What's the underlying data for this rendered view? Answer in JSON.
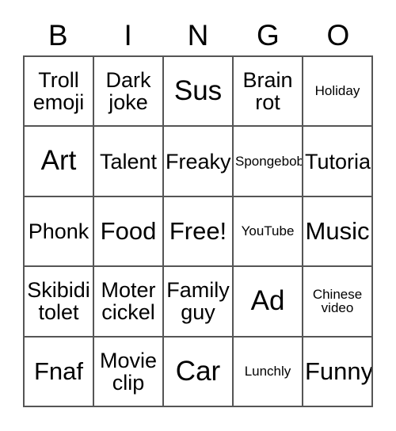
{
  "card": {
    "header_letters": [
      "B",
      "I",
      "N",
      "G",
      "O"
    ],
    "rows": [
      [
        {
          "text": "Troll\nemoji",
          "size": "md"
        },
        {
          "text": "Dark\njoke",
          "size": "md"
        },
        {
          "text": "Sus",
          "size": "xl"
        },
        {
          "text": "Brain\nrot",
          "size": "md"
        },
        {
          "text": "Holiday",
          "size": "sm"
        }
      ],
      [
        {
          "text": "Art",
          "size": "xl"
        },
        {
          "text": "Talent",
          "size": "md"
        },
        {
          "text": "Freaky",
          "size": "md"
        },
        {
          "text": "Spongebob",
          "size": "sm"
        },
        {
          "text": "Tutorial",
          "size": "md"
        }
      ],
      [
        {
          "text": "Phonk",
          "size": "md"
        },
        {
          "text": "Food",
          "size": "lg"
        },
        {
          "text": "Free!",
          "size": "lg"
        },
        {
          "text": "YouTube",
          "size": "sm"
        },
        {
          "text": "Music",
          "size": "lg"
        }
      ],
      [
        {
          "text": "Skibidi\ntolet",
          "size": "md"
        },
        {
          "text": "Moter\ncickel",
          "size": "md"
        },
        {
          "text": "Family\nguy",
          "size": "md"
        },
        {
          "text": "Ad",
          "size": "xl"
        },
        {
          "text": "Chinese\nvideo",
          "size": "sm"
        }
      ],
      [
        {
          "text": "Fnaf",
          "size": "lg"
        },
        {
          "text": "Movie\nclip",
          "size": "md"
        },
        {
          "text": "Car",
          "size": "xl"
        },
        {
          "text": "Lunchly",
          "size": "sm"
        },
        {
          "text": "Funny",
          "size": "lg"
        }
      ]
    ]
  },
  "colors": {
    "background": "#ffffff",
    "text": "#000000",
    "border": "#555555"
  }
}
